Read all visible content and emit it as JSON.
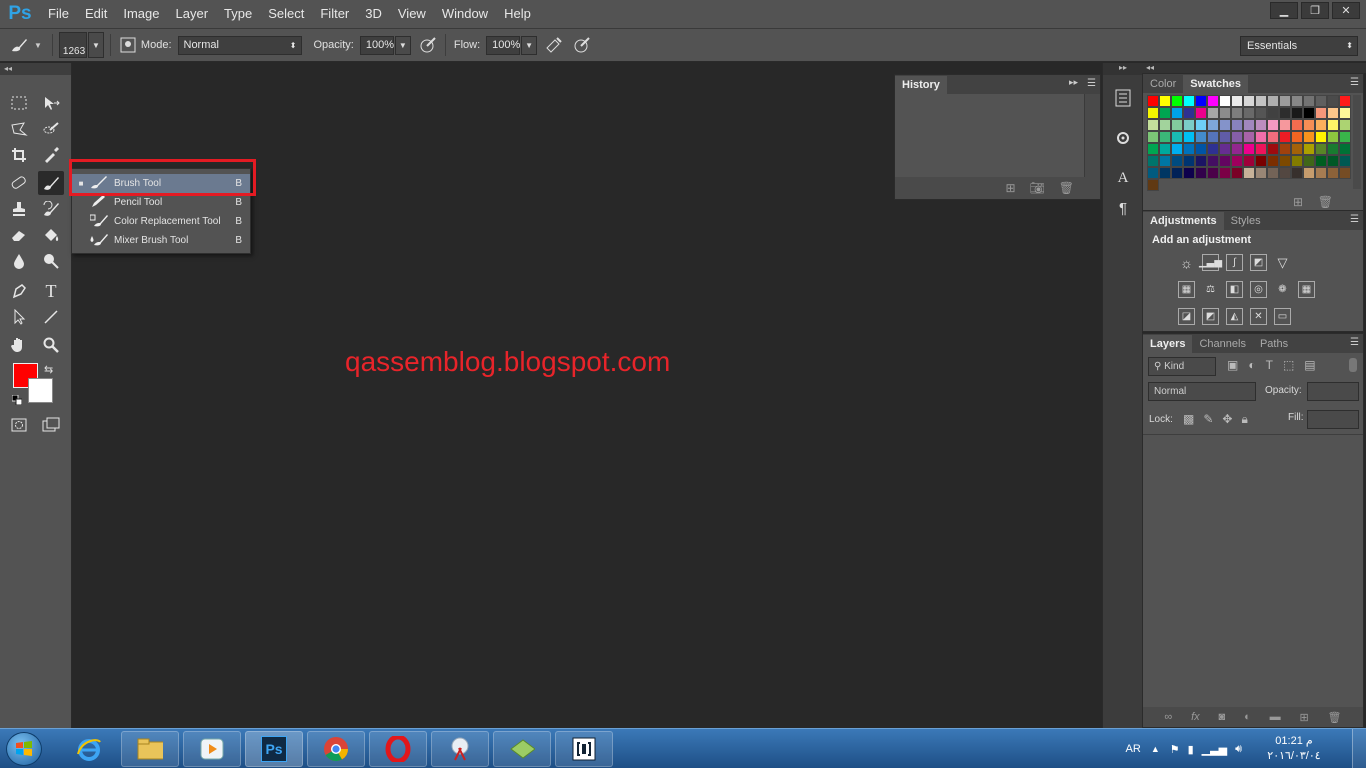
{
  "app": {
    "logo": "Ps"
  },
  "menu": [
    "File",
    "Edit",
    "Image",
    "Layer",
    "Type",
    "Select",
    "Filter",
    "3D",
    "View",
    "Window",
    "Help"
  ],
  "window_controls": {
    "minimize": "▁",
    "restore": "❐",
    "close": "✕"
  },
  "options": {
    "brush_size": "1263",
    "mode_label": "Mode:",
    "mode_value": "Normal",
    "opacity_label": "Opacity:",
    "opacity_value": "100%",
    "flow_label": "Flow:",
    "flow_value": "100%",
    "workspace": "Essentials"
  },
  "toolbar": {
    "collapse": "◂◂"
  },
  "colors": {
    "foreground": "#ff0000",
    "background": "#ffffff"
  },
  "canvas": {
    "watermark": "qassemblog.blogspot.com"
  },
  "flyout": {
    "items": [
      {
        "label": "Brush Tool",
        "key": "B",
        "selected": true
      },
      {
        "label": "Pencil Tool",
        "key": "B",
        "selected": false
      },
      {
        "label": "Color Replacement Tool",
        "key": "B",
        "selected": false
      },
      {
        "label": "Mixer Brush Tool",
        "key": "B",
        "selected": false
      }
    ]
  },
  "history": {
    "tab": "History"
  },
  "color_panel": {
    "tabs": [
      "Color",
      "Swatches"
    ]
  },
  "swatches": [
    "#ff0000",
    "#ffff00",
    "#00ff00",
    "#00ffff",
    "#0000ff",
    "#ff00ff",
    "#ffffff",
    "#ebebeb",
    "#d7d7d7",
    "#c3c3c3",
    "#afafaf",
    "#9b9b9b",
    "#878787",
    "#737373",
    "#5f5f5f",
    "#4b4b4b",
    "#ff1a1a",
    "#f6f600",
    "#00a651",
    "#00a2e8",
    "#2e3192",
    "#ec008c",
    "#a6a6a6",
    "#8c8c8c",
    "#7d7d7d",
    "#696969",
    "#555555",
    "#414141",
    "#2d2d2d",
    "#191919",
    "#000000",
    "#f7977a",
    "#fdc68a",
    "#fff79a",
    "#c4df9b",
    "#a2d39c",
    "#82ca9d",
    "#7bcdc8",
    "#6ecff6",
    "#7ea7d8",
    "#8493ca",
    "#8882be",
    "#a187be",
    "#bc8dbf",
    "#f49ac2",
    "#f6989d",
    "#f26c4f",
    "#f68e55",
    "#fbaf5c",
    "#fff467",
    "#acd372",
    "#7cc576",
    "#3bb878",
    "#1abbb4",
    "#00bff3",
    "#438ccb",
    "#5574b9",
    "#605ca8",
    "#855fa8",
    "#a763a8",
    "#f06eaa",
    "#f26d7d",
    "#ed1c24",
    "#f26522",
    "#f7941d",
    "#fff200",
    "#8dc73f",
    "#39b54a",
    "#00a651",
    "#00a99d",
    "#00aeef",
    "#0072bc",
    "#0054a6",
    "#2e3192",
    "#662d91",
    "#92278f",
    "#ec008c",
    "#ed145b",
    "#9e0b0f",
    "#a0410d",
    "#a36209",
    "#aba000",
    "#598527",
    "#197b30",
    "#007236",
    "#00746b",
    "#0076a3",
    "#004b80",
    "#003471",
    "#1b1464",
    "#440e62",
    "#630460",
    "#9e005d",
    "#9e0039",
    "#790000",
    "#7b2e00",
    "#7d4900",
    "#827b00",
    "#406618",
    "#005e20",
    "#005826",
    "#005952",
    "#005b7f",
    "#003663",
    "#002157",
    "#0d004c",
    "#32004b",
    "#4b0049",
    "#7b0046",
    "#7a0026",
    "#c7b299",
    "#998675",
    "#736357",
    "#534741",
    "#37302d",
    "#c69c6d",
    "#a67c52",
    "#8c6239",
    "#754c24",
    "#603913"
  ],
  "adjustments": {
    "tabs": [
      "Adjustments",
      "Styles"
    ],
    "title": "Add an adjustment"
  },
  "layers": {
    "tabs": [
      "Layers",
      "Channels",
      "Paths"
    ],
    "kind": "Kind",
    "blend": "Normal",
    "opacity_label": "Opacity:",
    "lock_label": "Lock:",
    "fill_label": "Fill:"
  },
  "taskbar": {
    "ps_label": "Ps",
    "lang": "AR",
    "time": "01:21 م",
    "date": "٢٠١٦/٠٣/٠٤"
  }
}
